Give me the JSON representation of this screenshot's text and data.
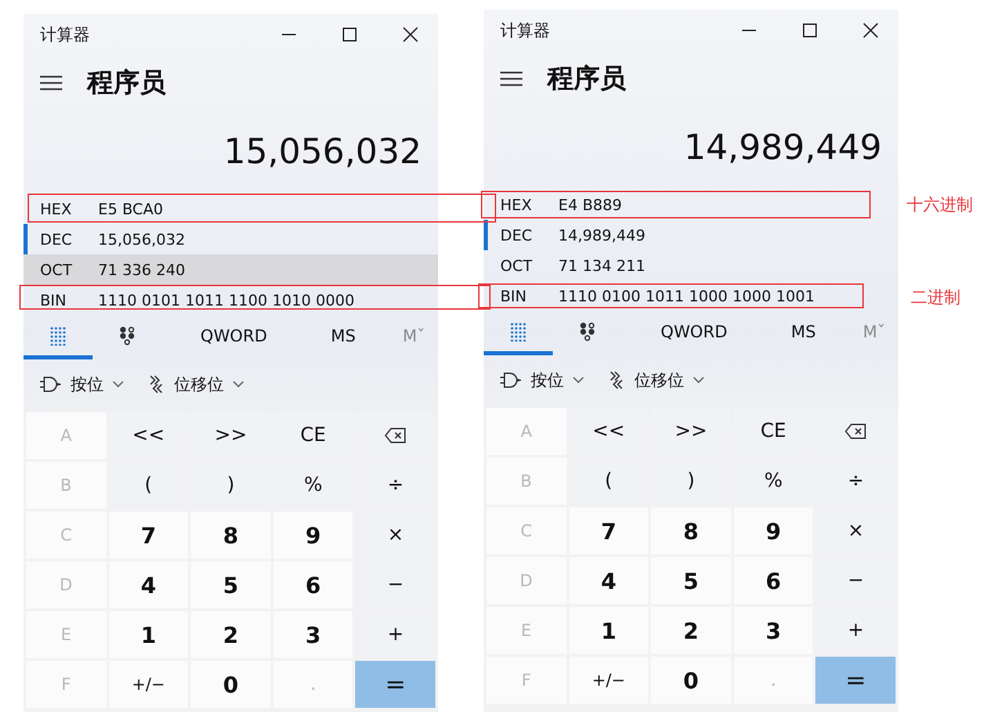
{
  "panes": [
    {
      "title": "计算器",
      "mode": "程序员",
      "display": "15,056,032",
      "radix": [
        {
          "label": "HEX",
          "value": "E5 BCA0",
          "selected": false,
          "hovered": false
        },
        {
          "label": "DEC",
          "value": "15,056,032",
          "selected": true,
          "hovered": false
        },
        {
          "label": "OCT",
          "value": "71 336 240",
          "selected": false,
          "hovered": true
        },
        {
          "label": "BIN",
          "value": "1110 0101 1011 1100 1010 0000",
          "selected": false,
          "hovered": false
        }
      ],
      "tabs": [
        {
          "kind": "keypad",
          "selected": true
        },
        {
          "kind": "bits",
          "selected": false
        },
        {
          "kind": "text",
          "label": "QWORD",
          "selected": false
        },
        {
          "kind": "text",
          "label": "MS",
          "selected": false
        },
        {
          "kind": "faint",
          "label": "Mˇ",
          "selected": false
        }
      ],
      "bitwise": [
        {
          "kind": "gate",
          "label": "按位"
        },
        {
          "kind": "shift",
          "label": "位移位"
        }
      ],
      "keys": [
        {
          "kind": "disabled",
          "label": "A"
        },
        {
          "kind": "op",
          "label": "<<"
        },
        {
          "kind": "op",
          "label": ">>"
        },
        {
          "kind": "op",
          "label": "CE"
        },
        {
          "kind": "backspace"
        },
        {
          "kind": "disabled",
          "label": "B"
        },
        {
          "kind": "op",
          "label": "("
        },
        {
          "kind": "op",
          "label": ")"
        },
        {
          "kind": "op",
          "label": "%"
        },
        {
          "kind": "op",
          "label": "÷"
        },
        {
          "kind": "disabled",
          "label": "C"
        },
        {
          "kind": "num",
          "label": "7"
        },
        {
          "kind": "num",
          "label": "8"
        },
        {
          "kind": "num",
          "label": "9"
        },
        {
          "kind": "op",
          "label": "×"
        },
        {
          "kind": "disabled",
          "label": "D"
        },
        {
          "kind": "num",
          "label": "4"
        },
        {
          "kind": "num",
          "label": "5"
        },
        {
          "kind": "num",
          "label": "6"
        },
        {
          "kind": "op",
          "label": "−"
        },
        {
          "kind": "disabled",
          "label": "E"
        },
        {
          "kind": "num",
          "label": "1"
        },
        {
          "kind": "num",
          "label": "2"
        },
        {
          "kind": "num",
          "label": "3"
        },
        {
          "kind": "op",
          "label": "+"
        },
        {
          "kind": "disabled",
          "label": "F"
        },
        {
          "kind": "sign",
          "label": "+/−"
        },
        {
          "kind": "num",
          "label": "0"
        },
        {
          "kind": "dim",
          "label": "."
        },
        {
          "kind": "equals",
          "label": "="
        }
      ]
    },
    {
      "title": "计算器",
      "mode": "程序员",
      "display": "14,989,449",
      "radix": [
        {
          "label": "HEX",
          "value": "E4 B889",
          "selected": false,
          "hovered": false
        },
        {
          "label": "DEC",
          "value": "14,989,449",
          "selected": true,
          "hovered": false
        },
        {
          "label": "OCT",
          "value": "71 134 211",
          "selected": false,
          "hovered": false
        },
        {
          "label": "BIN",
          "value": "1110 0100 1011 1000 1000 1001",
          "selected": false,
          "hovered": false
        }
      ],
      "tabs": [
        {
          "kind": "keypad",
          "selected": true
        },
        {
          "kind": "bits",
          "selected": false
        },
        {
          "kind": "text",
          "label": "QWORD",
          "selected": false
        },
        {
          "kind": "text",
          "label": "MS",
          "selected": false
        },
        {
          "kind": "faint",
          "label": "Mˇ",
          "selected": false
        }
      ],
      "bitwise": [
        {
          "kind": "gate",
          "label": "按位"
        },
        {
          "kind": "shift",
          "label": "位移位"
        }
      ],
      "keys": [
        {
          "kind": "disabled",
          "label": "A"
        },
        {
          "kind": "op",
          "label": "<<"
        },
        {
          "kind": "op",
          "label": ">>"
        },
        {
          "kind": "op",
          "label": "CE"
        },
        {
          "kind": "backspace"
        },
        {
          "kind": "disabled",
          "label": "B"
        },
        {
          "kind": "op",
          "label": "("
        },
        {
          "kind": "op",
          "label": ")"
        },
        {
          "kind": "op",
          "label": "%"
        },
        {
          "kind": "op",
          "label": "÷"
        },
        {
          "kind": "disabled",
          "label": "C"
        },
        {
          "kind": "num",
          "label": "7"
        },
        {
          "kind": "num",
          "label": "8"
        },
        {
          "kind": "num",
          "label": "9"
        },
        {
          "kind": "op",
          "label": "×"
        },
        {
          "kind": "disabled",
          "label": "D"
        },
        {
          "kind": "num",
          "label": "4"
        },
        {
          "kind": "num",
          "label": "5"
        },
        {
          "kind": "num",
          "label": "6"
        },
        {
          "kind": "op",
          "label": "−"
        },
        {
          "kind": "disabled",
          "label": "E"
        },
        {
          "kind": "num",
          "label": "1"
        },
        {
          "kind": "num",
          "label": "2"
        },
        {
          "kind": "num",
          "label": "3"
        },
        {
          "kind": "op",
          "label": "+"
        },
        {
          "kind": "disabled",
          "label": "F"
        },
        {
          "kind": "sign",
          "label": "+/−"
        },
        {
          "kind": "num",
          "label": "0"
        },
        {
          "kind": "dim",
          "label": "."
        },
        {
          "kind": "equals",
          "label": "="
        }
      ]
    }
  ],
  "annotations": [
    {
      "label": "十六进制"
    },
    {
      "label": "二进制"
    }
  ]
}
